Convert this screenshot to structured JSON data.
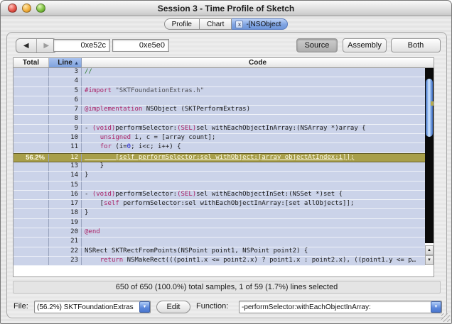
{
  "window": {
    "title": "Session 3 - Time Profile of Sketch"
  },
  "tabs": [
    {
      "label": "Profile",
      "selected": false
    },
    {
      "label": "Chart",
      "selected": false
    },
    {
      "label": "-[NSObject",
      "selected": true,
      "close_glyph": "x"
    }
  ],
  "toolbar": {
    "back_glyph": "◀",
    "forward_glyph": "▶",
    "address_field_1": "0xe52c",
    "address_field_2": "0xe5e0",
    "view_buttons": [
      {
        "label": "Source",
        "selected": true
      },
      {
        "label": "Assembly",
        "selected": false
      },
      {
        "label": "Both",
        "selected": false
      }
    ]
  },
  "table": {
    "columns": [
      {
        "label": "Total"
      },
      {
        "label": "Line",
        "sorted": true,
        "sort_arrow": "▲"
      },
      {
        "label": "Code"
      }
    ],
    "rows": [
      {
        "line": "3",
        "total": "",
        "hl": false,
        "seg": [
          [
            "c",
            "//"
          ]
        ]
      },
      {
        "line": "4",
        "total": "",
        "hl": false,
        "seg": []
      },
      {
        "line": "5",
        "total": "",
        "hl": false,
        "seg": [
          [
            "k",
            "#import"
          ],
          [
            "p",
            " "
          ],
          [
            "s",
            "\"SKTFoundationExtras.h\""
          ]
        ]
      },
      {
        "line": "6",
        "total": "",
        "hl": false,
        "seg": []
      },
      {
        "line": "7",
        "total": "",
        "hl": false,
        "seg": [
          [
            "k",
            "@implementation"
          ],
          [
            "p",
            " NSObject (SKTPerformExtras)"
          ]
        ]
      },
      {
        "line": "8",
        "total": "",
        "hl": false,
        "seg": []
      },
      {
        "line": "9",
        "total": "",
        "hl": false,
        "seg": [
          [
            "p",
            "- "
          ],
          [
            "k",
            "(void)"
          ],
          [
            "p",
            "performSelector:"
          ],
          [
            "k",
            "(SEL)"
          ],
          [
            "p",
            "sel withEachObjectInArray:(NSArray *)array {"
          ]
        ]
      },
      {
        "line": "10",
        "total": "",
        "hl": false,
        "seg": [
          [
            "p",
            "    "
          ],
          [
            "k",
            "unsigned"
          ],
          [
            "p",
            " i, c = [array count];"
          ]
        ]
      },
      {
        "line": "11",
        "total": "",
        "hl": false,
        "seg": [
          [
            "p",
            "    "
          ],
          [
            "k",
            "for"
          ],
          [
            "p",
            " (i="
          ],
          [
            "n",
            "0"
          ],
          [
            "p",
            "; i<c; i++) {"
          ]
        ]
      },
      {
        "line": "12",
        "total": "56.2%",
        "hl": true,
        "seg": [
          [
            "p",
            "        [self performSelector:sel withObject:[array objectAtIndex:i]];"
          ]
        ]
      },
      {
        "line": "13",
        "total": "",
        "hl": false,
        "seg": [
          [
            "p",
            "    }"
          ]
        ]
      },
      {
        "line": "14",
        "total": "",
        "hl": false,
        "seg": [
          [
            "p",
            "}"
          ]
        ]
      },
      {
        "line": "15",
        "total": "",
        "hl": false,
        "seg": []
      },
      {
        "line": "16",
        "total": "",
        "hl": false,
        "seg": [
          [
            "p",
            "- "
          ],
          [
            "k",
            "(void)"
          ],
          [
            "p",
            "performSelector:"
          ],
          [
            "k",
            "(SEL)"
          ],
          [
            "p",
            "sel withEachObjectInSet:(NSSet *)set {"
          ]
        ]
      },
      {
        "line": "17",
        "total": "",
        "hl": false,
        "seg": [
          [
            "p",
            "    ["
          ],
          [
            "k",
            "self"
          ],
          [
            "p",
            " performSelector:sel withEachObjectInArray:[set allObjects]];"
          ]
        ]
      },
      {
        "line": "18",
        "total": "",
        "hl": false,
        "seg": [
          [
            "p",
            "}"
          ]
        ]
      },
      {
        "line": "19",
        "total": "",
        "hl": false,
        "seg": []
      },
      {
        "line": "20",
        "total": "",
        "hl": false,
        "seg": [
          [
            "k",
            "@end"
          ]
        ]
      },
      {
        "line": "21",
        "total": "",
        "hl": false,
        "seg": []
      },
      {
        "line": "22",
        "total": "",
        "hl": false,
        "seg": [
          [
            "p",
            "NSRect SKTRectFromPoints(NSPoint point1, NSPoint point2) {"
          ]
        ]
      },
      {
        "line": "23",
        "total": "",
        "hl": false,
        "seg": [
          [
            "p",
            "    "
          ],
          [
            "k",
            "return"
          ],
          [
            "p",
            " NSMakeRect(((point1.x <= point2.x) ? point1.x : point2.x), ((point1.y <= p…"
          ]
        ]
      }
    ]
  },
  "scrollbar": {
    "up_glyph": "▲",
    "down_glyph": "▼"
  },
  "status_bar": {
    "text": "650 of 650 (100.0%) total samples, 1 of 59 (1.7%) lines selected"
  },
  "footer": {
    "file_label": "File:",
    "file_value": "(56.2%) SKTFoundationExtras",
    "edit_button": "Edit",
    "function_label": "Function:",
    "function_value": "-performSelector:withEachObjectInArray:",
    "dropdown_glyph": "▼"
  },
  "colors": {
    "row_background": "#cbd3e9",
    "highlight_row": "#a89f4a",
    "highlight_text": "#fffdea",
    "keyword": "#ab2166",
    "number": "#1a1acc",
    "sorted_column_header": "#7da1dd",
    "scrollbar_track": "#0a0a0a",
    "scrollbar_thumb": "#78a3e3",
    "hotspot_marker": "#b3a94f",
    "combo_button": "#5b87da"
  }
}
